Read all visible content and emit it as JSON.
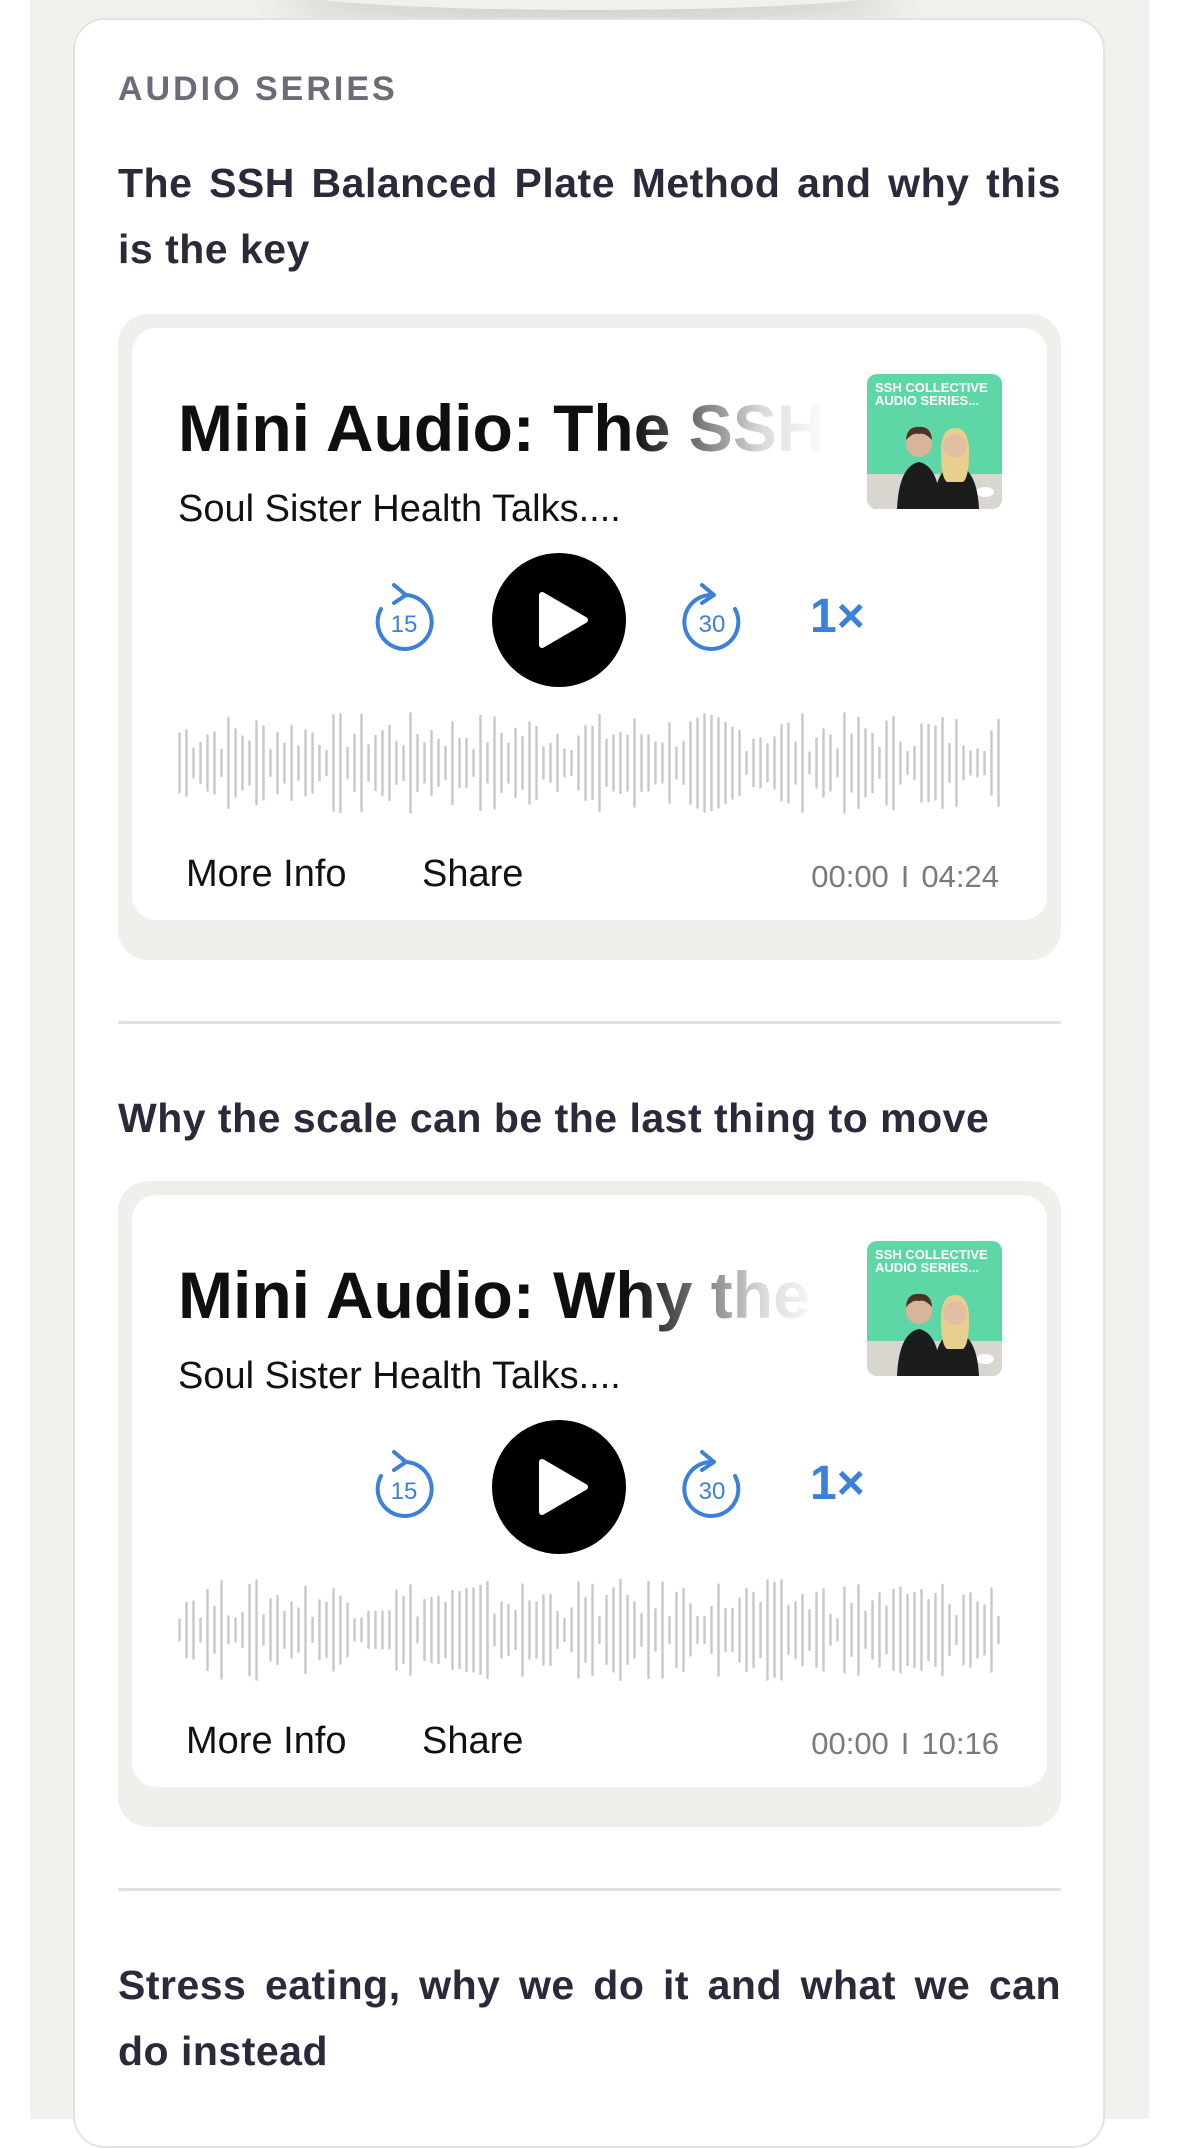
{
  "section_label": "AUDIO SERIES",
  "colors": {
    "accent": "#3b80d9",
    "play": "#000000",
    "cover_bg": "#5fd6a5",
    "waveform": "#c8c8c8"
  },
  "cover_art": {
    "text": "SSH COLLECTIVE AUDIO SERIES..."
  },
  "icons": {
    "rewind": "rewind-15-icon",
    "forward": "forward-30-icon",
    "play": "play-icon"
  },
  "episodes": [
    {
      "section_title": "The SSH Balanced Plate Method and why this is the key",
      "title": "Mini Audio: The SSH Balanced Plate Method and why this is the key",
      "show": "Soul Sister Health Talks....",
      "rewind_label": "15",
      "forward_label": "30",
      "speed": "1×",
      "more_info": "More Info",
      "share": "Share",
      "current_time": "00:00",
      "time_separator": "I",
      "duration": "04:24"
    },
    {
      "section_title": "Why the scale can be the last thing to move",
      "title": "Mini Audio: Why the scale can be the last thing to move",
      "show": "Soul Sister Health Talks....",
      "rewind_label": "15",
      "forward_label": "30",
      "speed": "1×",
      "more_info": "More Info",
      "share": "Share",
      "current_time": "00:00",
      "time_separator": "I",
      "duration": "10:16"
    },
    {
      "section_title": "Stress eating, why we do it and what we can do instead"
    }
  ]
}
